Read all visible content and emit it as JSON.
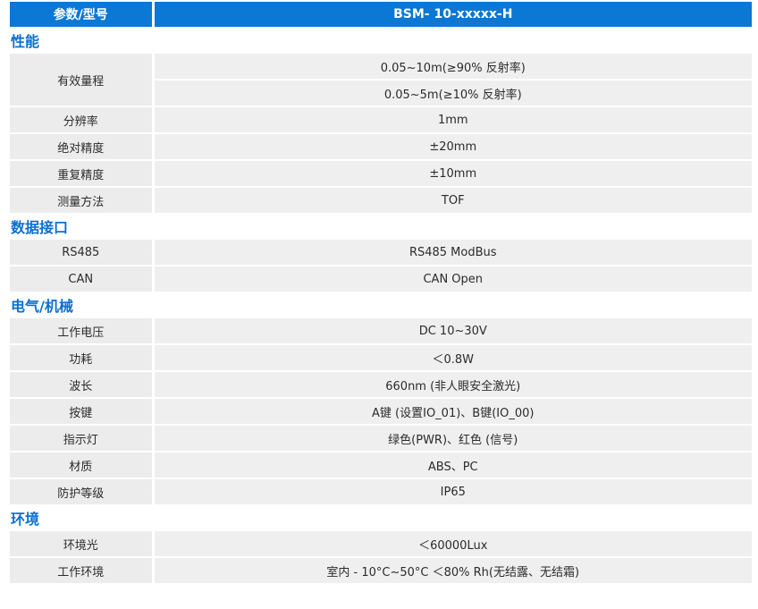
{
  "header": {
    "param_label": "参数/型号",
    "model": "BSM- 10-xxxxx-H"
  },
  "sections": {
    "performance": {
      "title": "性能",
      "range_label": "有效量程",
      "range_value_1": "0.05~10m(≥90% 反射率)",
      "range_value_2": "0.05~5m(≥10% 反射率)",
      "resolution_label": "分辨率",
      "resolution_value": "1mm",
      "abs_accuracy_label": "绝对精度",
      "abs_accuracy_value": "±20mm",
      "repeat_accuracy_label": "重复精度",
      "repeat_accuracy_value": "±10mm",
      "method_label": "测量方法",
      "method_value": "TOF"
    },
    "interface": {
      "title": "数据接口",
      "rs485_label": "RS485",
      "rs485_value": "RS485 ModBus",
      "can_label": "CAN",
      "can_value": "CAN Open"
    },
    "electrical": {
      "title": "电气/机械",
      "voltage_label": "工作电压",
      "voltage_value": "DC 10~30V",
      "power_label": "功耗",
      "power_value": "＜0.8W",
      "wavelength_label": "波长",
      "wavelength_value": "660nm (非人眼安全激光)",
      "keys_label": "按键",
      "keys_value": "A键 (设置IO_01)、B键(IO_00)",
      "indicator_label": "指示灯",
      "indicator_value": "绿色(PWR)、红色 (信号)",
      "material_label": "材质",
      "material_value": "ABS、PC",
      "protection_label": "防护等级",
      "protection_value": "IP65"
    },
    "environment": {
      "title": "环境",
      "light_label": "环境光",
      "light_value": "＜60000Lux",
      "work_env_label": "工作环境",
      "work_env_value": "室内 - 10°C~50°C ＜80% Rh(无结露、无结霜)"
    }
  },
  "colors": {
    "header_bg": "#0a78d4",
    "section_title": "#0a6fd0",
    "row_bg": "#ececec"
  }
}
